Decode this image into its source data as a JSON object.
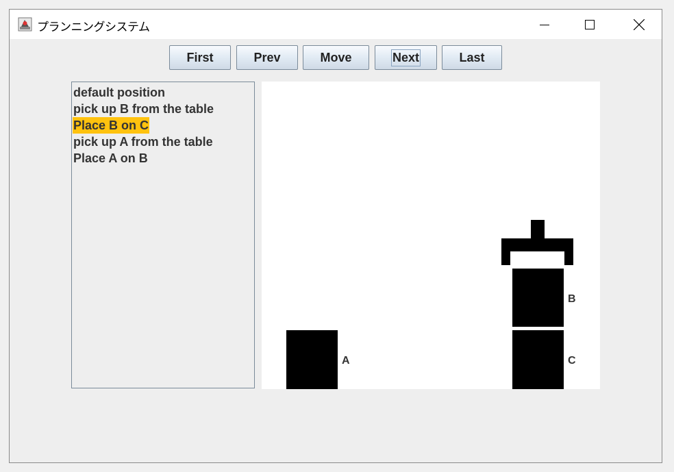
{
  "window": {
    "title": "プランニングシステム"
  },
  "toolbar": {
    "buttons": [
      {
        "label": "First"
      },
      {
        "label": "Prev"
      },
      {
        "label": "Move"
      },
      {
        "label": "Next"
      },
      {
        "label": "Last"
      }
    ]
  },
  "plan": {
    "steps": [
      "default position",
      "pick up B from the table",
      "Place B on C",
      "pick up A from the table",
      "Place A on B"
    ],
    "selected_index": 2
  },
  "scene": {
    "blocks": [
      {
        "label": "A"
      },
      {
        "label": "B"
      },
      {
        "label": "C"
      }
    ]
  },
  "colors": {
    "selection": "#ffc20e",
    "block": "#000000",
    "canvas": "#ffffff"
  }
}
